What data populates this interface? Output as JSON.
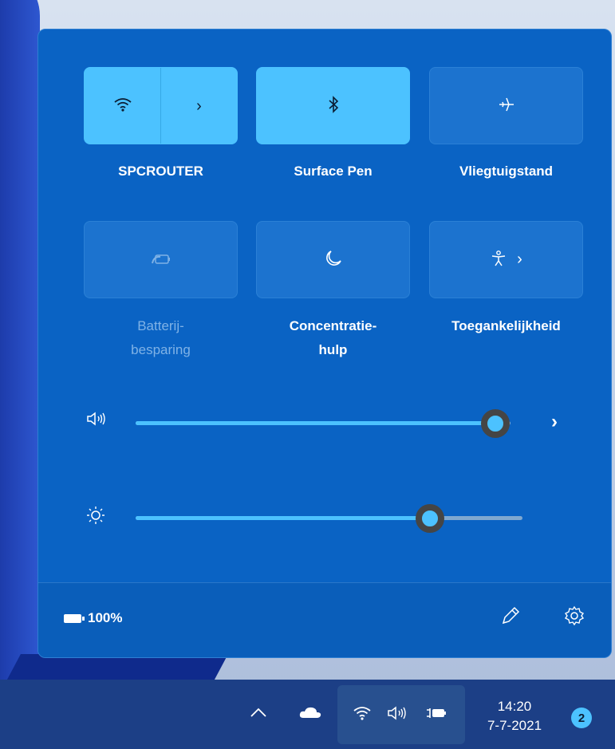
{
  "tiles": [
    {
      "label": "SPCROUTER",
      "icon": "wifi-icon",
      "state": "on",
      "has_chevron": true
    },
    {
      "label": "Surface Pen",
      "icon": "bluetooth-icon",
      "state": "on"
    },
    {
      "label": "Vliegtuigstand",
      "icon": "airplane-icon",
      "state": "off"
    },
    {
      "label_line1": "Batterij-",
      "label_line2": "besparing",
      "icon": "battery-saver-icon",
      "state": "disabled"
    },
    {
      "label_line1": "Concentratie-",
      "label_line2": "hulp",
      "icon": "moon-icon",
      "state": "off"
    },
    {
      "label": "Toegankelijkheid",
      "icon": "accessibility-icon",
      "state": "off",
      "has_chevron": true
    }
  ],
  "sliders": {
    "volume": {
      "icon": "speaker-icon",
      "value_fraction": 0.96
    },
    "brightness": {
      "icon": "sun-icon",
      "value_fraction": 0.76
    }
  },
  "footer": {
    "battery_percent": "100%",
    "edit_icon": "pencil-icon",
    "settings_icon": "gear-icon"
  },
  "taskbar": {
    "time": "14:20",
    "date": "7-7-2021",
    "notification_count": "2",
    "icons": [
      "chevron-up-icon",
      "cloud-icon",
      "wifi-icon",
      "speaker-icon",
      "battery-charging-icon"
    ]
  },
  "colors": {
    "panel": "#0a63c4",
    "accent": "#4cc2ff",
    "taskbar": "#1c3f86"
  }
}
